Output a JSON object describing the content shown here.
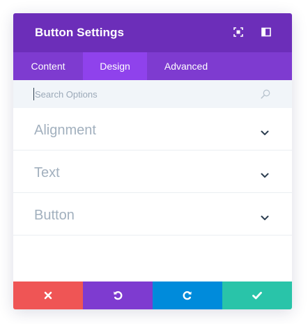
{
  "header": {
    "title": "Button Settings",
    "expand_icon": "expand-icon",
    "split_icon": "split-view-icon"
  },
  "tabs": [
    {
      "label": "Content",
      "active": false
    },
    {
      "label": "Design",
      "active": true
    },
    {
      "label": "Advanced",
      "active": false
    }
  ],
  "search": {
    "placeholder": "Search Options",
    "value": "",
    "icon": "search-icon"
  },
  "sections": [
    {
      "label": "Alignment",
      "icon": "chevron-down-icon"
    },
    {
      "label": "Text",
      "icon": "chevron-down-icon"
    },
    {
      "label": "Button",
      "icon": "chevron-down-icon"
    }
  ],
  "footer": {
    "buttons": [
      {
        "name": "cancel",
        "icon": "close-icon",
        "color": "#ef5555"
      },
      {
        "name": "undo",
        "icon": "undo-icon",
        "color": "#7e3bd0"
      },
      {
        "name": "redo",
        "icon": "redo-icon",
        "color": "#008bdb"
      },
      {
        "name": "save",
        "icon": "check-icon",
        "color": "#29c4a9"
      }
    ]
  },
  "colors": {
    "header": "#6c2eb9",
    "tabs": "#7e3bd0",
    "active_tab": "#8f42ec",
    "search_bg": "#f1f5f9",
    "section_text": "#a2b0be"
  }
}
